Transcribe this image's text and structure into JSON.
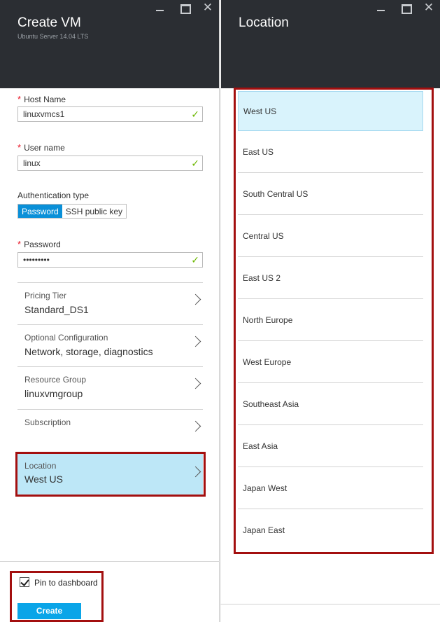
{
  "create_blade": {
    "title": "Create VM",
    "subtitle": "Ubuntu Server 14.04 LTS",
    "controls": {
      "minimize_icon": "minimize-icon",
      "maximize_icon": "maximize-icon",
      "close_icon": "close-icon",
      "close_glyph": "✕"
    },
    "host_name": {
      "required": "*",
      "label": "Host Name",
      "value": "linuxvmcs1",
      "valid_glyph": "✓"
    },
    "user_name": {
      "required": "*",
      "label": "User name",
      "value": "linux",
      "valid_glyph": "✓"
    },
    "auth_type": {
      "label": "Authentication type",
      "options": [
        "Password",
        "SSH public key"
      ],
      "selected": "Password"
    },
    "password": {
      "required": "*",
      "label": "Password",
      "value": "•••••••••",
      "valid_glyph": "✓"
    },
    "rows": [
      {
        "label": "Pricing Tier",
        "value": "Standard_DS1"
      },
      {
        "label": "Optional Configuration",
        "value": "Network, storage, diagnostics"
      },
      {
        "label": "Resource Group",
        "value": "linuxvmgroup"
      },
      {
        "label": "Subscription",
        "value": ""
      },
      {
        "label": "Location",
        "value": "West US"
      }
    ],
    "pin": {
      "label": "Pin to dashboard",
      "checked": true
    },
    "create_label": "Create"
  },
  "location_blade": {
    "title": "Location",
    "controls": {
      "close_glyph": "✕"
    },
    "items": [
      "West US",
      "East US",
      "South Central US",
      "Central US",
      "East US 2",
      "North Europe",
      "West Europe",
      "Southeast Asia",
      "East Asia",
      "Japan West",
      "Japan East"
    ],
    "selected": "West US"
  },
  "colors": {
    "header_bg": "#2b2e33",
    "accent": "#0aa5e8",
    "selected_row": "#bde7f7",
    "highlight_box": "#a30f0f",
    "valid_check": "#6bb700",
    "required": "#e81123"
  }
}
